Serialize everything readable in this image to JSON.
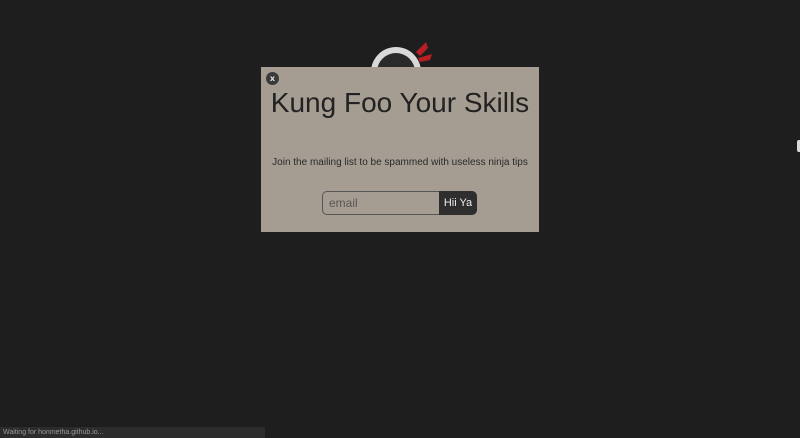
{
  "background_color": "#1e1e1e",
  "logo": {
    "icon": "ninja-head-icon",
    "accent_color": "#b81f24"
  },
  "modal": {
    "background_color": "#a59d92",
    "close_label": "x",
    "title": "Kung Foo Your Skills",
    "subtitle": "Join the mailing list to be spammed with useless ninja tips",
    "form": {
      "email_placeholder": "email",
      "email_value": "",
      "submit_label": "Hii Ya"
    }
  },
  "status_bar": {
    "text": "Waiting for honmetha.github.io..."
  }
}
